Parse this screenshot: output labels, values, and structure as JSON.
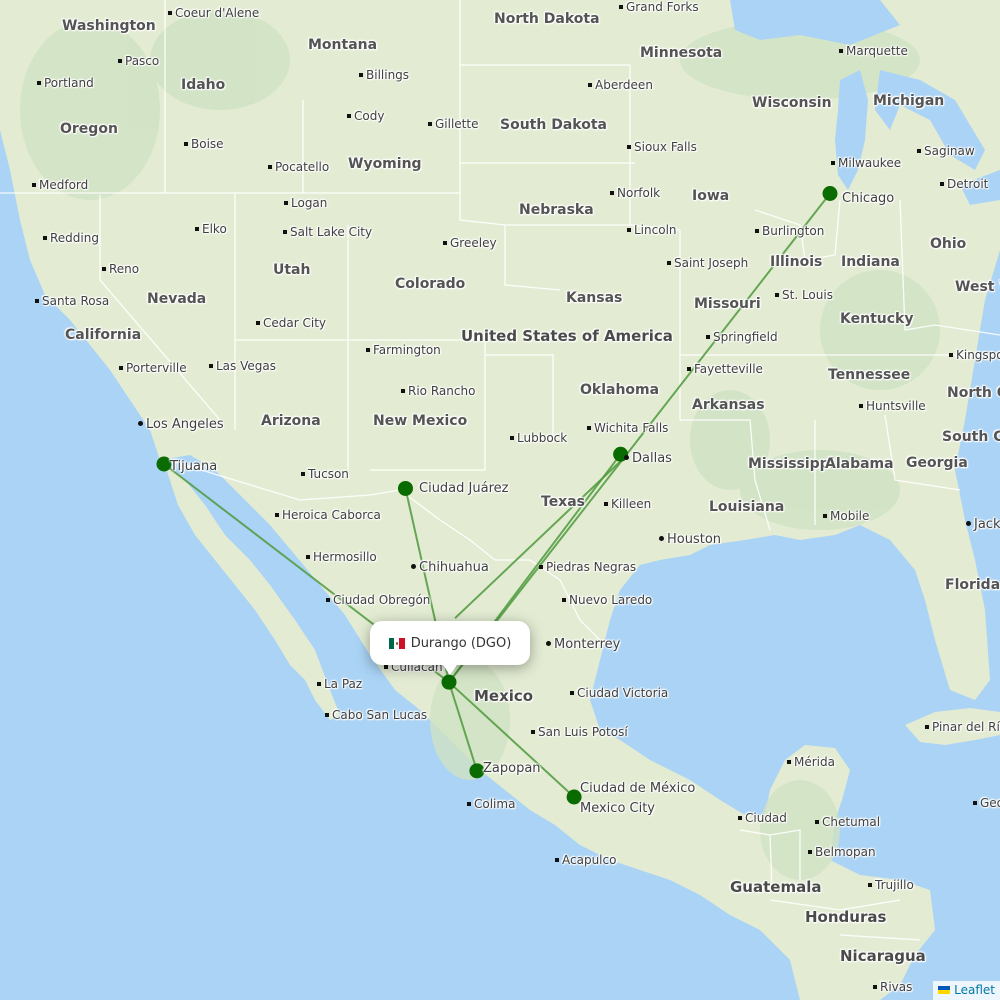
{
  "map": {
    "colors": {
      "water": "#aad3f5",
      "land": "#e2ecd2",
      "forest": "#cfe3c6",
      "border": "#ffffff",
      "route": "#4f9a3d",
      "marker": "#0a6b00"
    },
    "popup": {
      "flag": "mexico-flag",
      "text": "Durango (DGO)"
    },
    "origin": {
      "name": "Durango (DGO)",
      "lat": 24.12,
      "lon": -104.53
    },
    "destinations": [
      {
        "name": "Tijuana",
        "lat": 32.54,
        "lon": -116.97
      },
      {
        "name": "Ciudad Juárez",
        "lat": 31.63,
        "lon": -106.43
      },
      {
        "name": "Dallas",
        "lat": 32.9,
        "lon": -97.04
      },
      {
        "name": "Chicago",
        "lat": 41.97,
        "lon": -87.9
      },
      {
        "name": "Zapopan",
        "lat": 20.52,
        "lon": -103.31
      },
      {
        "name": "Ciudad de México / Mexico City",
        "lat": 19.44,
        "lon": -99.07
      }
    ],
    "labels": {
      "countries": [
        "United States of America",
        "Mexico",
        "Guatemala",
        "Honduras",
        "Nicaragua"
      ],
      "regions": [
        "Washington",
        "Montana",
        "North Dakota",
        "Minnesota",
        "Idaho",
        "Oregon",
        "South Dakota",
        "Wisconsin",
        "Michigan",
        "Wyoming",
        "Iowa",
        "Nebraska",
        "Nevada",
        "Utah",
        "Colorado",
        "Illinois",
        "Indiana",
        "Ohio",
        "California",
        "Kansas",
        "Missouri",
        "West V",
        "Kentucky",
        "Oklahoma",
        "Tennessee",
        "Arkansas",
        "North C",
        "Arizona",
        "New Mexico",
        "South Ca",
        "Mississippi",
        "Alabama",
        "Georgia",
        "Texas",
        "Louisiana",
        "Florida"
      ],
      "cities": [
        "Coeur d'Alene",
        "Grand Forks",
        "Pasco",
        "Portland",
        "Billings",
        "Aberdeen",
        "Marquette",
        "Boise",
        "Cody",
        "Gillette",
        "Sioux Falls",
        "Saginaw",
        "Pocatello",
        "Milwaukee",
        "Medford",
        "Norfolk",
        "Detroit",
        "Chicago",
        "Logan",
        "Elko",
        "Salt Lake City",
        "Redding",
        "Greeley",
        "Lincoln",
        "Burlington",
        "Reno",
        "Saint Joseph",
        "Santa Rosa",
        "St. Louis",
        "Cedar City",
        "Springfield",
        "Farmington",
        "Kingspo",
        "Porterville",
        "Las Vegas",
        "Fayetteville",
        "Rio Rancho",
        "Huntsville",
        "Los Angeles",
        "Wichita Falls",
        "Lubbock",
        "Dallas",
        "Tijuana",
        "Tucson",
        "Ciudad Juárez",
        "Killeen",
        "Heroica Caborca",
        "Mobile",
        "Jack",
        "Houston",
        "Hermosillo",
        "Chihuahua",
        "Piedras Negras",
        "Ciudad Obregón",
        "Nuevo Laredo",
        "Monterrey",
        "Culiacán",
        "La Paz",
        "Ciudad Victoria",
        "Cabo San Lucas",
        "San Luis Potosí",
        "Pinar del Río",
        "Mérida",
        "Zapopan",
        "Ciudad de México",
        "Mexico City",
        "Colima",
        "Ciudad",
        "Chetumal",
        "Geo",
        "Acapulco",
        "Belmopan",
        "Trujillo",
        "Rivas"
      ]
    },
    "attribution": {
      "flag": "ukraine-flag",
      "text": "Leaflet"
    }
  }
}
